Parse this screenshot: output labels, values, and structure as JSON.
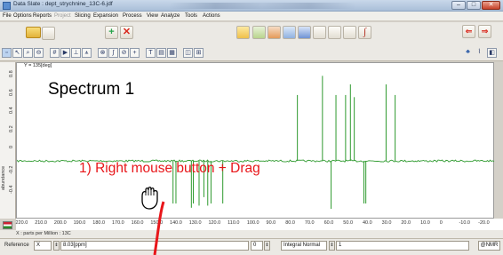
{
  "window": {
    "title": "Data Slate : dept_strychnine_13C-6.jdf",
    "minimize_glyph": "–",
    "maximize_glyph": "□",
    "close_glyph": "✕"
  },
  "menu": [
    "File",
    "Options",
    "Reports",
    "Project",
    "Slicing",
    "Expansion",
    "Process",
    "View",
    "Analyze",
    "Tools",
    "Actions"
  ],
  "toolbar1": {
    "add_icon": "plus-icon",
    "delete_icon": "x-icon",
    "prev_label": "⇐",
    "next_label": "⇒"
  },
  "plot": {
    "y_top_label": "Y = 135[deg]",
    "spectrum_label": "Spectrum 1",
    "instruction": "1) Right mouse button + Drag",
    "y_axis_title": "abundance",
    "y_ticks": [
      "0.8",
      "0.6",
      "0.4",
      "0.2",
      "0",
      "-0.2",
      "-0.4"
    ],
    "x_ticks": [
      "220.0",
      "210.0",
      "200.0",
      "190.0",
      "180.0",
      "170.0",
      "160.0",
      "150.0",
      "140.0",
      "130.0",
      "120.0",
      "110.0",
      "100.0",
      "90.0",
      "80.0",
      "70.0",
      "60.0",
      "50.0",
      "40.0",
      "30.0",
      "20.0",
      "10.0",
      "0",
      "-10.0",
      "-20.0"
    ],
    "x_axis_title": "X : parts per Million : 13C",
    "trace_color": "#2e9a2e",
    "annotation_color": "#e8161a"
  },
  "chart_data": {
    "type": "line",
    "title": "",
    "xlabel": "X : parts per Million : 13C",
    "ylabel": "abundance",
    "xlim": [
      223,
      -25
    ],
    "ylim": [
      -0.55,
      0.92
    ],
    "x_reversed": true,
    "grid": false,
    "peaks_ppm": [
      142.0,
      140.5,
      132.5,
      131.5,
      128.5,
      126.0,
      124.0,
      122.3,
      116.2,
      77.5,
      64.5,
      60.0,
      57.5,
      52.5,
      50.0,
      48.0,
      43.0,
      42.0,
      31.5,
      26.8
    ],
    "peak_heights": [
      -0.4,
      -0.4,
      -0.44,
      -0.4,
      -0.42,
      -0.34,
      -0.42,
      -0.4,
      -0.4,
      0.62,
      0.8,
      -0.45,
      0.62,
      0.62,
      0.72,
      0.6,
      -0.4,
      -0.4,
      0.72,
      0.62
    ],
    "baseline": 0
  },
  "statusbar": {
    "reference_label": "Reference",
    "axis_value": "X",
    "reference_value": "8.03[ppm]",
    "mid_value": "0",
    "integral_mode": "Integral Normal",
    "count_value": "1",
    "right_label": "@NMR"
  },
  "cursor": {
    "icon": "hand-grab-icon",
    "drag_color": "#e8161a"
  }
}
